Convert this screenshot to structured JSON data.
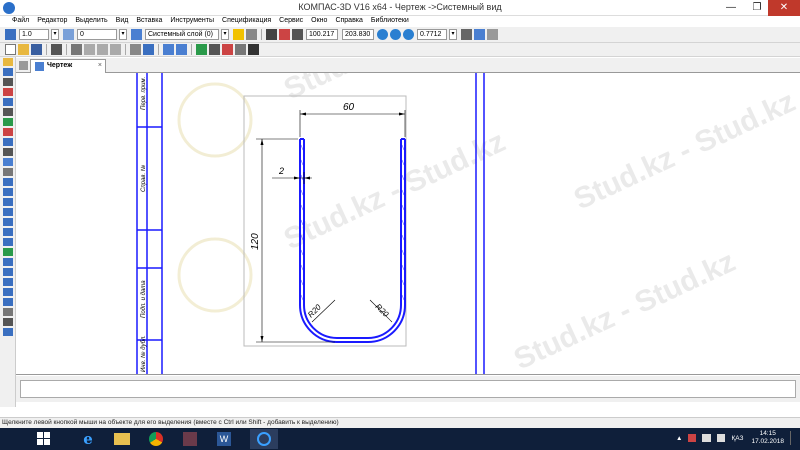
{
  "window": {
    "title": "КОМПАС-3D V16  x64 - Чертеж ->Системный вид",
    "minimize": "—",
    "maximize": "❐",
    "close": "✕"
  },
  "menu": [
    "Файл",
    "Редактор",
    "Выделить",
    "Вид",
    "Вставка",
    "Инструменты",
    "Спецификация",
    "Сервис",
    "Окно",
    "Справка",
    "Библиотеки"
  ],
  "toolbar": {
    "step_value": "1.0",
    "angle_value": "0",
    "layer_value": "Системный слой (0)",
    "coord_x": "100.217",
    "coord_y": "203.830",
    "zoom_value": "0.7712"
  },
  "tab": {
    "label": "Чертеж",
    "close": "×"
  },
  "drawing": {
    "dim_width": "60",
    "dim_height": "120",
    "dim_wall": "2",
    "radius_left": "R20",
    "radius_right": "R20",
    "stamp_labels": [
      "Перв. прим.",
      "Справ. №",
      "Подп. и дата",
      "Инв. № дубл."
    ]
  },
  "watermark": "Stud.kz - Stud.kz",
  "status": {
    "hint": "Щелкните левой кнопкой мыши на объекте для его выделения (вместе с Ctrl или Shift - добавить к выделению)"
  },
  "taskbar": {
    "lang": "ҚАЗ",
    "time": "14:15",
    "date": "17.02.2018"
  }
}
